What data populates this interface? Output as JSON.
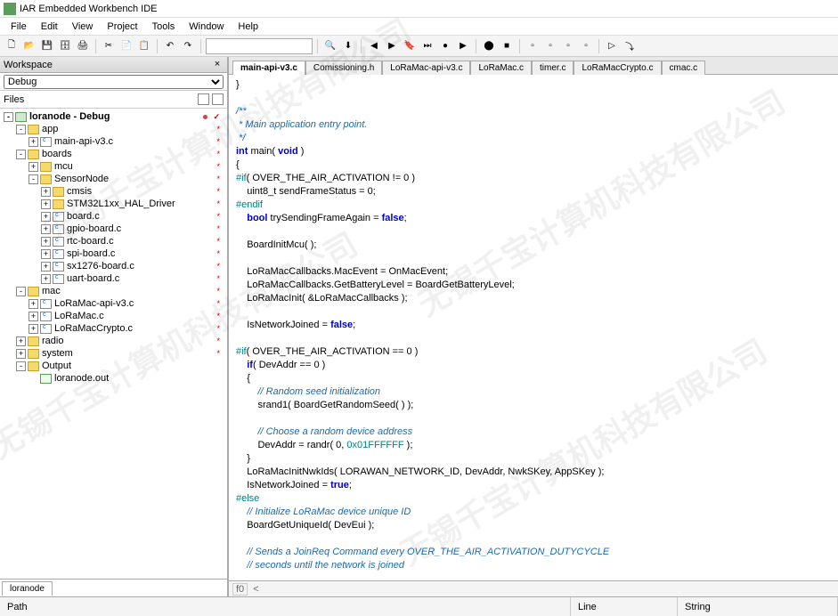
{
  "title": "IAR Embedded Workbench IDE",
  "menu": [
    "File",
    "Edit",
    "View",
    "Project",
    "Tools",
    "Window",
    "Help"
  ],
  "workspace": {
    "title": "Workspace",
    "config": "Debug",
    "files_label": "Files",
    "bottom_tab": "loranode"
  },
  "tree": [
    {
      "d": 0,
      "exp": "-",
      "ico": "proj",
      "label": "loranode - Debug",
      "bold": true,
      "mark": "✓",
      "dot": true
    },
    {
      "d": 1,
      "exp": "-",
      "ico": "folder",
      "label": "app",
      "mark": "*"
    },
    {
      "d": 2,
      "exp": "+",
      "ico": "file c",
      "label": "main-api-v3.c",
      "mark": "*"
    },
    {
      "d": 1,
      "exp": "-",
      "ico": "folder",
      "label": "boards",
      "mark": "*"
    },
    {
      "d": 2,
      "exp": "+",
      "ico": "folderc",
      "label": "mcu",
      "mark": "*"
    },
    {
      "d": 2,
      "exp": "-",
      "ico": "folder",
      "label": "SensorNode",
      "mark": "*"
    },
    {
      "d": 3,
      "exp": "+",
      "ico": "folderc",
      "label": "cmsis",
      "mark": "*"
    },
    {
      "d": 3,
      "exp": "+",
      "ico": "folderc",
      "label": "STM32L1xx_HAL_Driver",
      "mark": "*"
    },
    {
      "d": 3,
      "exp": "+",
      "ico": "file c",
      "label": "board.c",
      "mark": "*"
    },
    {
      "d": 3,
      "exp": "+",
      "ico": "file c",
      "label": "gpio-board.c",
      "mark": "*"
    },
    {
      "d": 3,
      "exp": "+",
      "ico": "file c",
      "label": "rtc-board.c",
      "mark": "*"
    },
    {
      "d": 3,
      "exp": "+",
      "ico": "file c",
      "label": "spi-board.c",
      "mark": "*"
    },
    {
      "d": 3,
      "exp": "+",
      "ico": "file c",
      "label": "sx1276-board.c",
      "mark": "*"
    },
    {
      "d": 3,
      "exp": "+",
      "ico": "file c",
      "label": "uart-board.c",
      "mark": "*"
    },
    {
      "d": 1,
      "exp": "-",
      "ico": "folder",
      "label": "mac",
      "mark": "*"
    },
    {
      "d": 2,
      "exp": "+",
      "ico": "file c",
      "label": "LoRaMac-api-v3.c",
      "mark": "*"
    },
    {
      "d": 2,
      "exp": "+",
      "ico": "file c",
      "label": "LoRaMac.c",
      "mark": "*"
    },
    {
      "d": 2,
      "exp": "+",
      "ico": "file c",
      "label": "LoRaMacCrypto.c",
      "mark": "*"
    },
    {
      "d": 1,
      "exp": "+",
      "ico": "folderc",
      "label": "radio",
      "mark": "*"
    },
    {
      "d": 1,
      "exp": "+",
      "ico": "folderc",
      "label": "system",
      "mark": "*"
    },
    {
      "d": 1,
      "exp": "-",
      "ico": "folder",
      "label": "Output"
    },
    {
      "d": 2,
      "exp": "",
      "ico": "out",
      "label": "loranode.out"
    }
  ],
  "tabs": [
    {
      "label": "main-api-v3.c",
      "active": true
    },
    {
      "label": "Comissioning.h"
    },
    {
      "label": "LoRaMac-api-v3.c"
    },
    {
      "label": "LoRaMac.c"
    },
    {
      "label": "timer.c"
    },
    {
      "label": "LoRaMacCrypto.c"
    },
    {
      "label": "cmac.c"
    }
  ],
  "code_lines": [
    {
      "t": "}",
      "cls": ""
    },
    {
      "t": "",
      "cls": ""
    },
    {
      "t": "/**",
      "cls": "cm"
    },
    {
      "t": " * Main application entry point.",
      "cls": "cm"
    },
    {
      "t": " */",
      "cls": "cm"
    },
    {
      "segs": [
        {
          "t": "int",
          "c": "bl"
        },
        {
          "t": " main( "
        },
        {
          "t": "void",
          "c": "bl"
        },
        {
          "t": " )"
        }
      ]
    },
    {
      "t": "{",
      "cls": ""
    },
    {
      "segs": [
        {
          "t": "#if",
          "c": "pp"
        },
        {
          "t": "( OVER_THE_AIR_ACTIVATION != 0 )"
        }
      ]
    },
    {
      "t": "    uint8_t sendFrameStatus = 0;",
      "cls": ""
    },
    {
      "t": "#endif",
      "cls": "pp"
    },
    {
      "segs": [
        {
          "t": "    "
        },
        {
          "t": "bool",
          "c": "bl"
        },
        {
          "t": " trySendingFrameAgain = "
        },
        {
          "t": "false",
          "c": "bl"
        },
        {
          "t": ";"
        }
      ]
    },
    {
      "t": "",
      "cls": ""
    },
    {
      "t": "    BoardInitMcu( );",
      "cls": ""
    },
    {
      "t": "",
      "cls": ""
    },
    {
      "t": "    LoRaMacCallbacks.MacEvent = OnMacEvent;",
      "cls": ""
    },
    {
      "t": "    LoRaMacCallbacks.GetBatteryLevel = BoardGetBatteryLevel;",
      "cls": ""
    },
    {
      "t": "    LoRaMacInit( &LoRaMacCallbacks );",
      "cls": ""
    },
    {
      "t": "",
      "cls": ""
    },
    {
      "segs": [
        {
          "t": "    IsNetworkJoined = "
        },
        {
          "t": "false",
          "c": "bl"
        },
        {
          "t": ";"
        }
      ]
    },
    {
      "t": "",
      "cls": ""
    },
    {
      "segs": [
        {
          "t": "#if",
          "c": "pp"
        },
        {
          "t": "( OVER_THE_AIR_ACTIVATION == 0 )"
        }
      ]
    },
    {
      "segs": [
        {
          "t": "    "
        },
        {
          "t": "if",
          "c": "bl"
        },
        {
          "t": "( DevAddr == 0 )"
        }
      ]
    },
    {
      "t": "    {",
      "cls": ""
    },
    {
      "t": "        // Random seed initialization",
      "cls": "cm"
    },
    {
      "t": "        srand1( BoardGetRandomSeed( ) );",
      "cls": ""
    },
    {
      "t": "",
      "cls": ""
    },
    {
      "t": "        // Choose a random device address",
      "cls": "cm"
    },
    {
      "segs": [
        {
          "t": "        DevAddr = randr( 0, "
        },
        {
          "t": "0x01FFFFFF",
          "c": "nm"
        },
        {
          "t": " );"
        }
      ]
    },
    {
      "t": "    }",
      "cls": ""
    },
    {
      "t": "    LoRaMacInitNwkIds( LORAWAN_NETWORK_ID, DevAddr, NwkSKey, AppSKey );",
      "cls": ""
    },
    {
      "segs": [
        {
          "t": "    IsNetworkJoined = "
        },
        {
          "t": "true",
          "c": "bl"
        },
        {
          "t": ";"
        }
      ]
    },
    {
      "t": "#else",
      "cls": "pp"
    },
    {
      "t": "    // Initialize LoRaMac device unique ID",
      "cls": "cm"
    },
    {
      "t": "    BoardGetUniqueId( DevEui );",
      "cls": ""
    },
    {
      "t": "",
      "cls": ""
    },
    {
      "t": "    // Sends a JoinReq Command every OVER_THE_AIR_ACTIVATION_DUTYCYCLE",
      "cls": "cm"
    },
    {
      "t": "    // seconds until the network is joined",
      "cls": "cm"
    }
  ],
  "gutter": {
    "f0": "f0",
    "arrow": "<"
  },
  "status": {
    "path": "Path",
    "line": "Line",
    "string": "String"
  },
  "toolbar_icons": [
    "new",
    "open",
    "save",
    "saveall",
    "print",
    "",
    "cut",
    "copy",
    "paste",
    "",
    "undo",
    "redo",
    "",
    "combo",
    "",
    "find",
    "findnext",
    "",
    "nav1",
    "nav2",
    "bookmark",
    "bookmarknext",
    "gobp",
    "run",
    "",
    "bp",
    "stop",
    "",
    "d1",
    "d2",
    "d3",
    "d4",
    "",
    "go",
    "step"
  ],
  "watermarks": [
    "无锡千宝计算机科技有限公司",
    "无锡千宝计算机科技有限公司",
    "无锡千宝计算机科技有限公司",
    "无锡千宝计算机科技有限公司"
  ]
}
